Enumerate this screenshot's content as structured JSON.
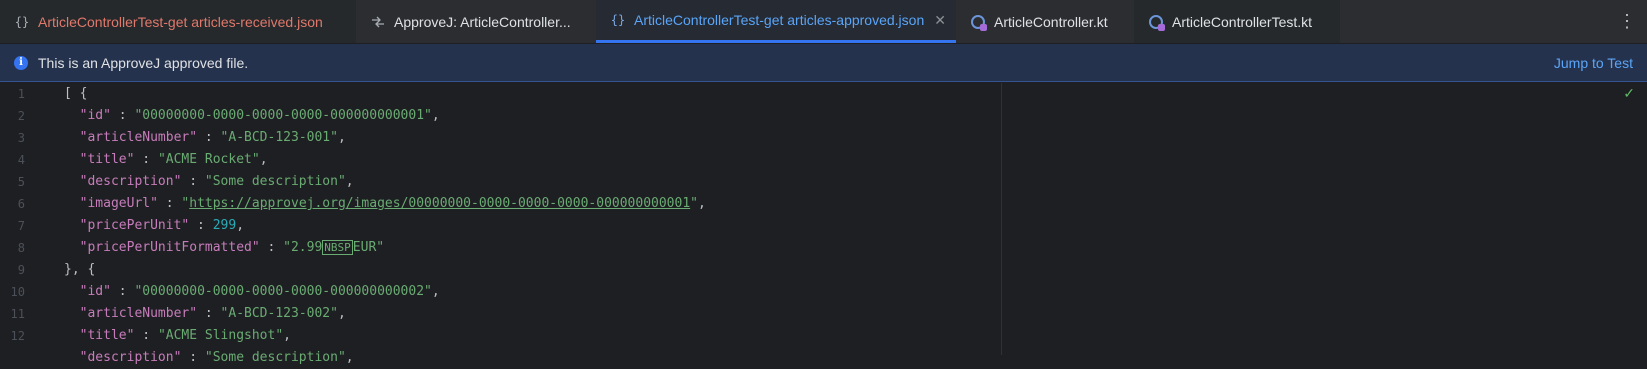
{
  "tabs": [
    {
      "label": "ArticleControllerTest-get articles-received.json",
      "icon": "json-braces-icon"
    },
    {
      "label": "ApproveJ: ArticleController...",
      "icon": "diff-icon"
    },
    {
      "label": "ArticleControllerTest-get articles-approved.json",
      "icon": "json-braces-icon",
      "active": true
    },
    {
      "label": "ArticleController.kt",
      "icon": "kotlin-class-icon"
    },
    {
      "label": "ArticleControllerTest.kt",
      "icon": "kotlin-class-icon"
    }
  ],
  "banner": {
    "message": "This is an ApproveJ approved file.",
    "action": "Jump to Test"
  },
  "editor": {
    "line_numbers": [
      "1",
      "2",
      "3",
      "4",
      "5",
      "6",
      "7",
      "8",
      "9",
      "10",
      "11",
      "12"
    ],
    "lines": [
      {
        "p": "[ {"
      },
      {
        "k": "\"id\"",
        "sep": " : ",
        "v": "\"00000000-0000-0000-0000-000000000001\"",
        "end": ","
      },
      {
        "k": "\"articleNumber\"",
        "sep": " : ",
        "v": "\"A-BCD-123-001\"",
        "end": ","
      },
      {
        "k": "\"title\"",
        "sep": " : ",
        "v": "\"ACME Rocket\"",
        "end": ","
      },
      {
        "k": "\"description\"",
        "sep": " : ",
        "v": "\"Some description\"",
        "end": ","
      },
      {
        "k": "\"imageUrl\"",
        "sep": " : ",
        "q1": "\"",
        "url": "https://approvej.org/images/00000000-0000-0000-0000-000000000001",
        "q2": "\"",
        "end": ","
      },
      {
        "k": "\"pricePerUnit\"",
        "sep": " : ",
        "num": "299",
        "end": ","
      },
      {
        "k": "\"pricePerUnitFormatted\"",
        "sep": " : ",
        "v1": "\"2.99",
        "nbsp": "NBSP",
        "v2": "EUR\"",
        "end": ""
      },
      {
        "p": "}, {"
      },
      {
        "k": "\"id\"",
        "sep": " : ",
        "v": "\"00000000-0000-0000-0000-000000000002\"",
        "end": ","
      },
      {
        "k": "\"articleNumber\"",
        "sep": " : ",
        "v": "\"A-BCD-123-002\"",
        "end": ","
      },
      {
        "k": "\"title\"",
        "sep": " : ",
        "v": "\"ACME Slingshot\"",
        "end": ","
      }
    ],
    "partial_line": {
      "k": "\"description\"",
      "sep": " : ",
      "v": "\"Some description\"",
      "end": ","
    }
  },
  "colors": {
    "accent": "#3574f0",
    "key": "#c77dbb",
    "string": "#6aab73",
    "number": "#2aacb8"
  }
}
